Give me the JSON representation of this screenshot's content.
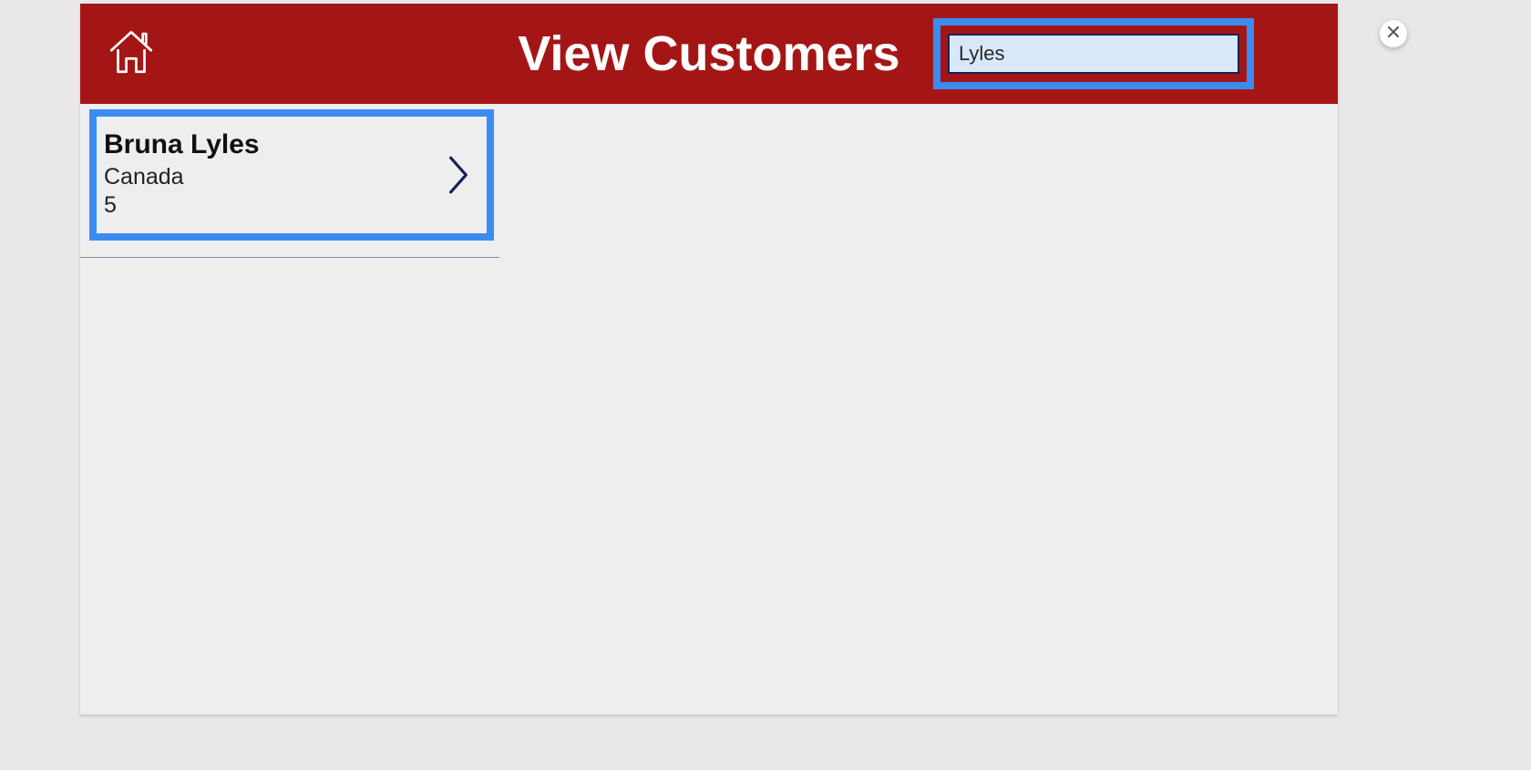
{
  "header": {
    "title": "View Customers",
    "search_value": "Lyles"
  },
  "customers": [
    {
      "name": "Bruna  Lyles",
      "country": "Canada",
      "id": "5"
    }
  ]
}
